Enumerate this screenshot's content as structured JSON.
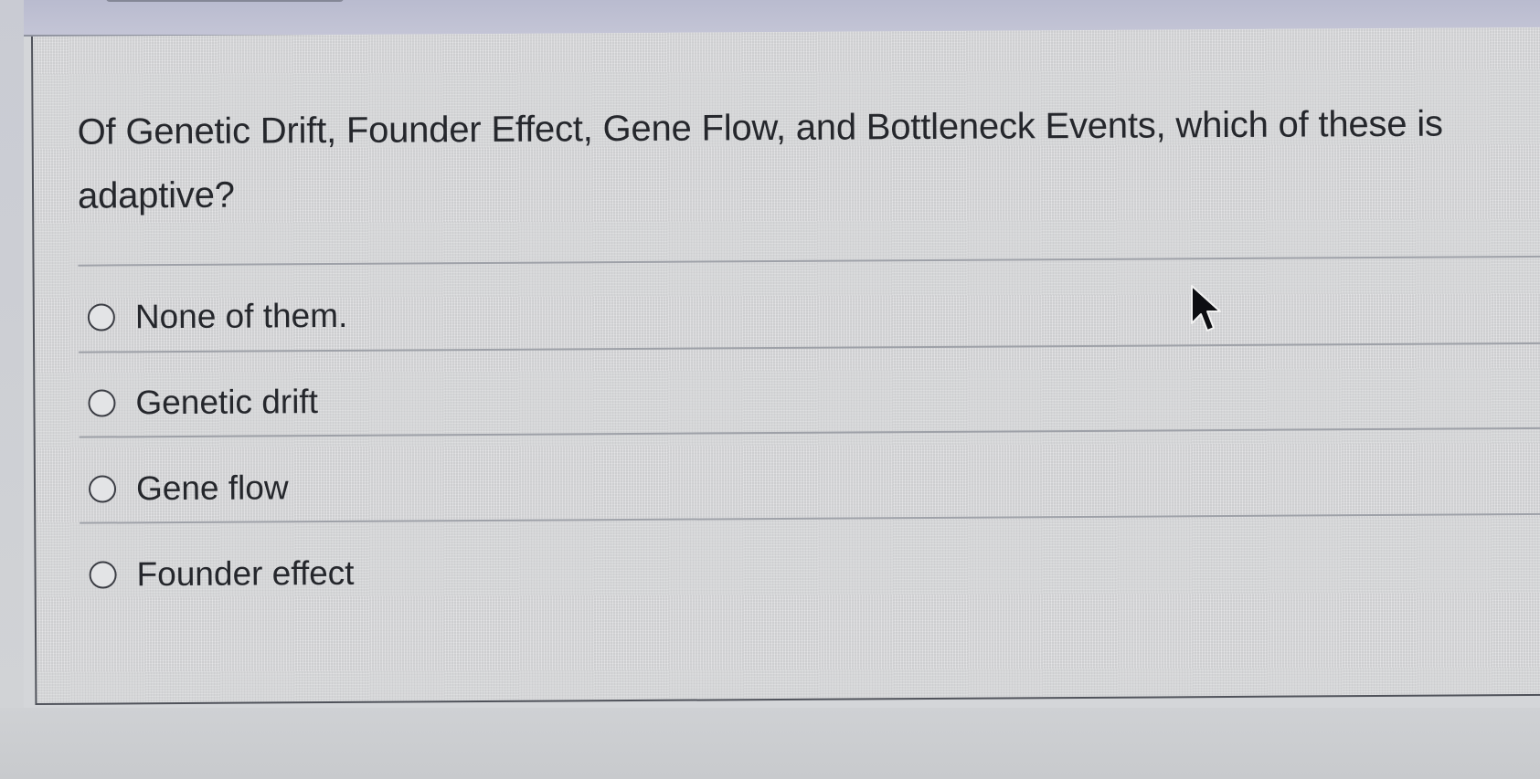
{
  "question": {
    "text": "Of Genetic Drift, Founder Effect, Gene Flow, and Bottleneck Events, which of these is adaptive?"
  },
  "answers": [
    {
      "label": "None of them.",
      "selected": false
    },
    {
      "label": "Genetic drift",
      "selected": false
    },
    {
      "label": "Gene flow",
      "selected": false
    },
    {
      "label": "Founder effect",
      "selected": false
    }
  ],
  "cursor": {
    "icon": "arrow-cursor-icon"
  },
  "colors": {
    "header_bar": "#c0c1d4",
    "panel_background": "#d9dadc",
    "text": "#25272c",
    "radio_border": "#3b3d44"
  }
}
